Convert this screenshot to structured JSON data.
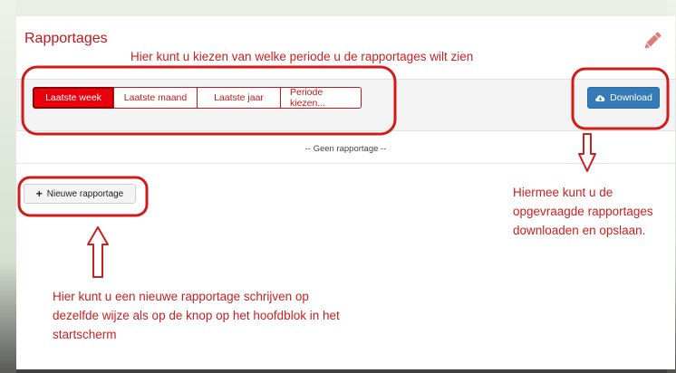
{
  "panel": {
    "title": "Rapportages",
    "edit_icon": "pencil-icon",
    "accent_color": "#c4161c"
  },
  "period_tabs": [
    {
      "label": "Laatste week",
      "active": true
    },
    {
      "label": "Laatste maand",
      "active": false
    },
    {
      "label": "Laatste jaar",
      "active": false
    },
    {
      "label": "Periode kiezen...",
      "active": false
    }
  ],
  "download": {
    "label": "Download",
    "icon": "cloud-download-icon",
    "color": "#337ab7"
  },
  "empty_state": "-- Geen rapportage --",
  "new_report": {
    "label": "Nieuwe rapportage",
    "icon": "plus-icon"
  },
  "annotations": {
    "top": "Hier kunt u kiezen van welke periode u de rapportages wilt zien",
    "right": "Hiermee kunt u de opgevraagde rapportages downloaden en opslaan.",
    "bottom": "Hier kunt u een nieuwe rapportage schrijven op dezelfde wijze als op de knop op het hoofdblok in het startscherm",
    "color": "#cc1f1f"
  }
}
